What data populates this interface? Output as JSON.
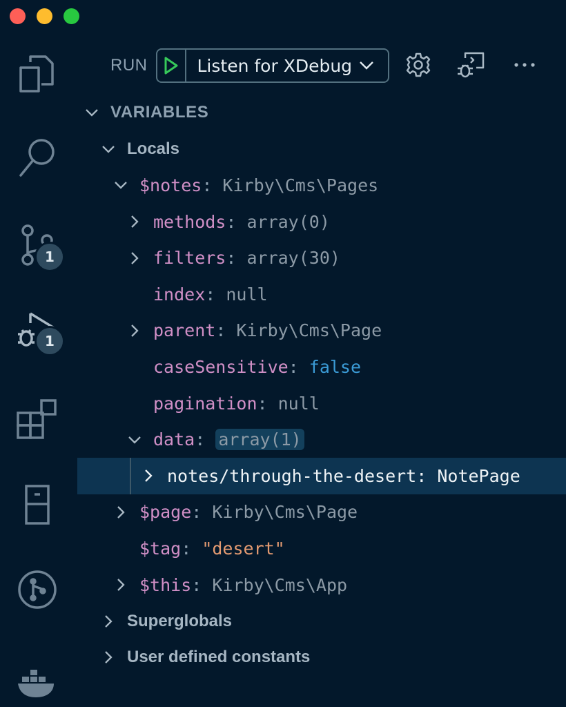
{
  "toolbar": {
    "run_label": "RUN",
    "config_name": "Listen for XDebug"
  },
  "activity_bar": {
    "scm_badge": "1",
    "debug_badge": "1"
  },
  "variables": {
    "section_title": "VARIABLES",
    "locals": {
      "title": "Locals",
      "notes": {
        "name": "$notes",
        "value": "Kirby\\Cms\\Pages",
        "children": {
          "methods": {
            "name": "methods",
            "value": "array(0)"
          },
          "filters": {
            "name": "filters",
            "value": "array(30)"
          },
          "index": {
            "name": "index",
            "value": "null"
          },
          "parent": {
            "name": "parent",
            "value": "Kirby\\Cms\\Page"
          },
          "caseSensitive": {
            "name": "caseSensitive",
            "value": "false"
          },
          "pagination": {
            "name": "pagination",
            "value": "null"
          },
          "data": {
            "name": "data",
            "value": "array(1)",
            "children": {
              "entry": {
                "name": "notes/through-the-desert",
                "value": "NotePage"
              }
            }
          }
        }
      },
      "page": {
        "name": "$page",
        "value": "Kirby\\Cms\\Page"
      },
      "tag": {
        "name": "$tag",
        "value": "\"desert\""
      },
      "this": {
        "name": "$this",
        "value": "Kirby\\Cms\\App"
      }
    },
    "superglobals_title": "Superglobals",
    "user_constants_title": "User defined constants"
  },
  "colors": {
    "background": "#03182b",
    "variable_name": "#d08fc6",
    "string_value": "#e39a71",
    "boolean_value": "#3b9bd6",
    "selection": "#0d3451",
    "play_green": "#36c95a"
  }
}
